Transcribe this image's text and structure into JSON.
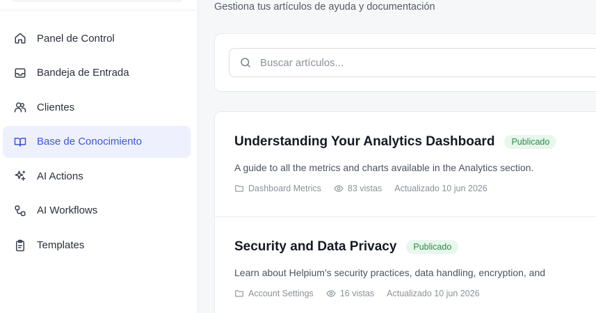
{
  "sidebar": {
    "items": [
      {
        "label": "Panel de Control",
        "icon": "home-icon"
      },
      {
        "label": "Bandeja de Entrada",
        "icon": "inbox-icon"
      },
      {
        "label": "Clientes",
        "icon": "users-icon"
      },
      {
        "label": "Base de Conocimiento",
        "icon": "book-open-icon",
        "active": true
      },
      {
        "label": "AI Actions",
        "icon": "sparkles-icon"
      },
      {
        "label": "AI Workflows",
        "icon": "workflow-icon"
      },
      {
        "label": "Templates",
        "icon": "clipboard-icon"
      }
    ],
    "active_color": "#3f55d6"
  },
  "main": {
    "subtitle": "Gestiona tus artículos de ayuda y documentación",
    "search": {
      "placeholder": "Buscar artículos..."
    },
    "articles": [
      {
        "title": "Understanding Your Analytics Dashboard",
        "status": "Publicado",
        "description": "A guide to all the metrics and charts available in the Analytics section.",
        "category": "Dashboard Metrics",
        "views": "83 vistas",
        "updated": "Actualizado 10 jun 2026"
      },
      {
        "title": "Security and Data Privacy",
        "status": "Publicado",
        "description": "Learn about Helpium's security practices, data handling, encryption, and",
        "category": "Account Settings",
        "views": "16 vistas",
        "updated": "Actualizado 10 jun 2026"
      }
    ],
    "status_color": "#2c8a4a"
  }
}
